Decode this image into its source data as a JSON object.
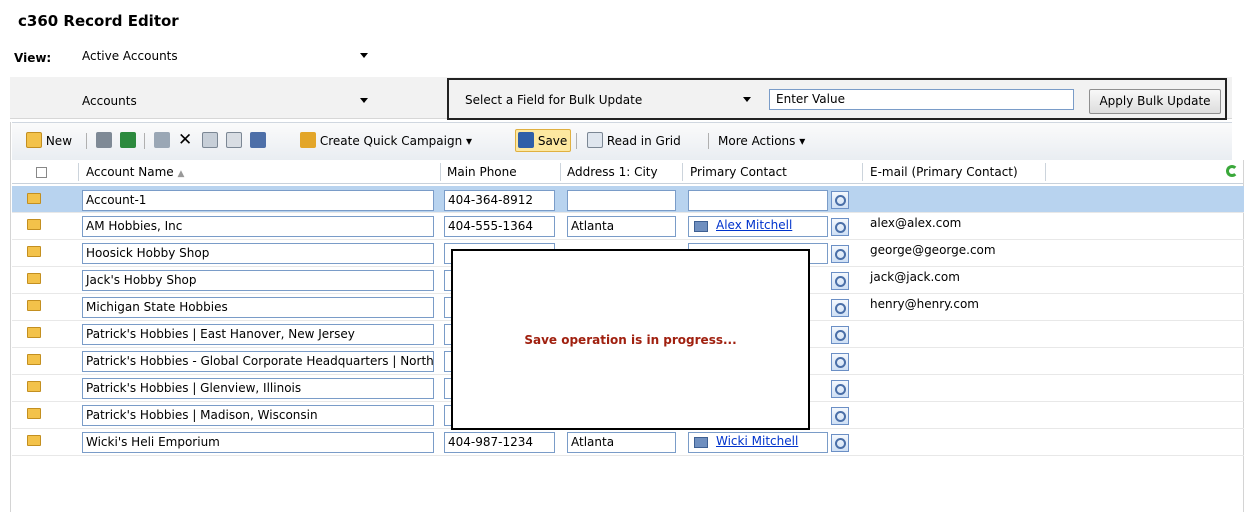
{
  "app": {
    "title": "c360 Record Editor"
  },
  "view": {
    "label": "View:",
    "selected": "Active Accounts"
  },
  "entity": {
    "selected": "Accounts"
  },
  "bulk": {
    "field_select": "Select a Field for Bulk Update",
    "value_input": "Enter Value",
    "apply_button": "Apply Bulk Update"
  },
  "toolbar": {
    "new_label": "New",
    "campaign_label": "Create Quick Campaign",
    "save_label": "Save",
    "read_grid_label": "Read in Grid",
    "more_actions_label": "More Actions"
  },
  "columns": [
    "Account Name",
    "Main Phone",
    "Address 1: City",
    "Primary Contact",
    "E-mail (Primary Contact)"
  ],
  "rows": [
    {
      "name": "Account-1",
      "phone": "404-364-8912",
      "city": "",
      "contact": "",
      "email": ""
    },
    {
      "name": "AM Hobbies, Inc",
      "phone": "404-555-1364",
      "city": "Atlanta",
      "contact": "Alex Mitchell",
      "email": "alex@alex.com"
    },
    {
      "name": "Hoosick Hobby Shop",
      "phone": "",
      "city": "",
      "contact": "",
      "email": "george@george.com"
    },
    {
      "name": "Jack's Hobby Shop",
      "phone": "",
      "city": "",
      "contact": "",
      "email": "jack@jack.com"
    },
    {
      "name": "Michigan State Hobbies",
      "phone": "",
      "city": "",
      "contact": "",
      "email": "henry@henry.com"
    },
    {
      "name": "Patrick's Hobbies  | East Hanover, New Jersey",
      "phone": "",
      "city": "",
      "contact": "",
      "email": ""
    },
    {
      "name": "Patrick's Hobbies - Global Corporate Headquarters | Northfie",
      "phone": "",
      "city": "",
      "contact": "",
      "email": ""
    },
    {
      "name": "Patrick's Hobbies | Glenview, Illinois",
      "phone": "",
      "city": "",
      "contact": "",
      "email": ""
    },
    {
      "name": "Patrick's Hobbies | Madison, Wisconsin",
      "phone": "",
      "city": "",
      "contact": "",
      "email": ""
    },
    {
      "name": "Wicki's Heli Emporium",
      "phone": "404-987-1234",
      "city": "Atlanta",
      "contact": "Wicki Mitchell",
      "email": ""
    }
  ],
  "overlay": {
    "message": "Save operation is in progress..."
  },
  "colors": {
    "selected_row": "#b8d3ef",
    "link": "#0033cc",
    "overlay_text": "#a0200f"
  }
}
